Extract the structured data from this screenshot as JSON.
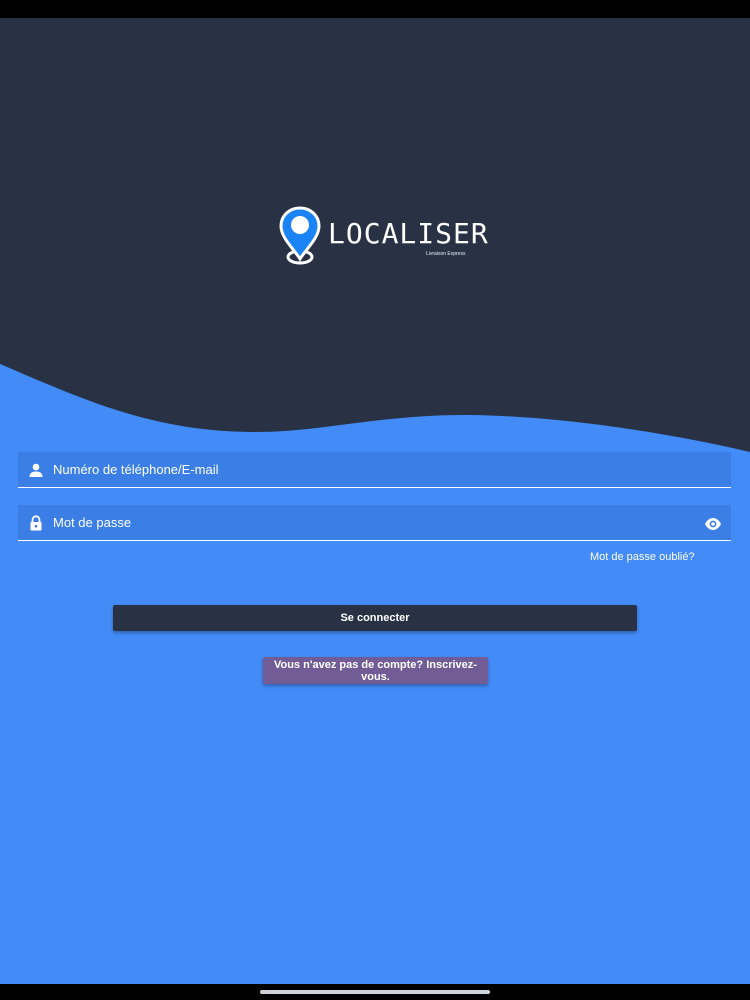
{
  "colors": {
    "header_bg": "#283244",
    "body_bg": "#438bf7",
    "field_bg": "#3b7fe6",
    "signup_bg": "#725c96",
    "pin_blue": "#1a83f5"
  },
  "logo": {
    "title": "LOCALISER",
    "tagline": "Livraison Express",
    "icon": "location-pin-icon"
  },
  "form": {
    "identifier": {
      "placeholder": "Numéro de téléphone/E-mail",
      "value": "",
      "icon": "person-icon"
    },
    "password": {
      "placeholder": "Mot de passe",
      "value": "",
      "icon": "lock-icon",
      "toggle_icon": "eye-icon"
    },
    "forgot_label": "Mot de passe oublié?",
    "login_label": "Se connecter",
    "signup_label": "Vous n'avez pas de compte? Inscrivez-vous."
  }
}
